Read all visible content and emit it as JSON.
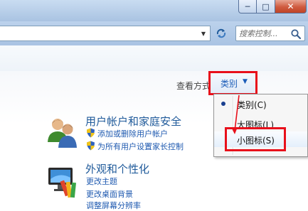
{
  "window": {
    "buttons": {
      "minimize": "─",
      "maximize": "□",
      "close": "✕"
    }
  },
  "toolbar": {
    "search_placeholder": "搜索控制..."
  },
  "view": {
    "view_by_label": "查看方式",
    "current": "类别",
    "dropdown_arrow": "▼",
    "options": [
      {
        "label": "类别(C)",
        "selected": true
      },
      {
        "label": "大图标(L)",
        "selected": false
      },
      {
        "label": "小图标(S)",
        "selected": false
      }
    ]
  },
  "categories": [
    {
      "title": "用户帐户和家庭安全",
      "icon": "users-icon",
      "links": [
        "添加或删除用户帐户",
        "为所有用户设置家长控制"
      ]
    },
    {
      "title": "外观和个性化",
      "icon": "appearance-icon",
      "links": [
        "更改主题",
        "更改桌面背景",
        "调整屏幕分辨率"
      ]
    }
  ],
  "colors": {
    "highlight": "#e8101b",
    "link": "#1f5ab0",
    "title_link": "#1f5a9a"
  }
}
